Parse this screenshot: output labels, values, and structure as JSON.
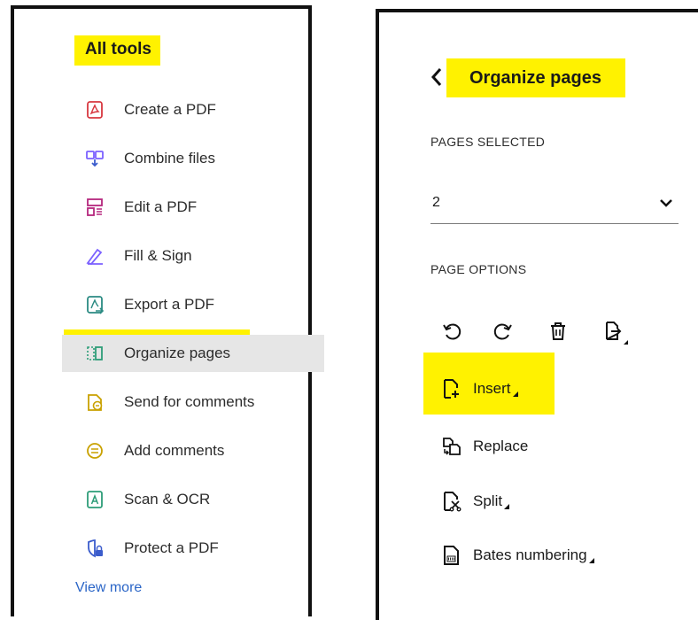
{
  "left_panel": {
    "title": "All tools",
    "items": [
      {
        "label": "Create a PDF",
        "icon": "create-pdf-icon"
      },
      {
        "label": "Combine files",
        "icon": "combine-files-icon"
      },
      {
        "label": "Edit a PDF",
        "icon": "edit-pdf-icon"
      },
      {
        "label": "Fill & Sign",
        "icon": "fill-sign-icon"
      },
      {
        "label": "Export a PDF",
        "icon": "export-pdf-icon"
      },
      {
        "label": "Organize pages",
        "icon": "organize-pages-icon",
        "selected": true
      },
      {
        "label": "Send for comments",
        "icon": "send-for-comments-icon"
      },
      {
        "label": "Add comments",
        "icon": "add-comments-icon"
      },
      {
        "label": "Scan & OCR",
        "icon": "scan-ocr-icon"
      },
      {
        "label": "Protect a PDF",
        "icon": "protect-pdf-icon"
      }
    ],
    "view_more": "View more"
  },
  "right_panel": {
    "title": "Organize pages",
    "pages_selected_label": "PAGES SELECTED",
    "pages_selected_value": "2",
    "page_options_label": "PAGE OPTIONS",
    "option_icons": [
      "rotate-left-icon",
      "rotate-right-icon",
      "delete-icon",
      "extract-icon"
    ],
    "options": [
      {
        "label": "Insert",
        "icon": "insert-page-icon",
        "has_menu": true
      },
      {
        "label": "Replace",
        "icon": "replace-page-icon",
        "has_menu": false
      },
      {
        "label": "Split",
        "icon": "split-icon",
        "has_menu": true
      },
      {
        "label": "Bates numbering",
        "icon": "bates-numbering-icon",
        "has_menu": true
      }
    ]
  },
  "colors": {
    "highlight": "#fff200",
    "link": "#2a65c7",
    "selected_bg": "#e6e6e6",
    "red": "#d7373f",
    "purple": "#7b61ff",
    "magenta": "#b5267d",
    "teal": "#2a8a82",
    "green": "#2d9d78",
    "amber": "#c9a100",
    "blue": "#3b5ccc"
  }
}
